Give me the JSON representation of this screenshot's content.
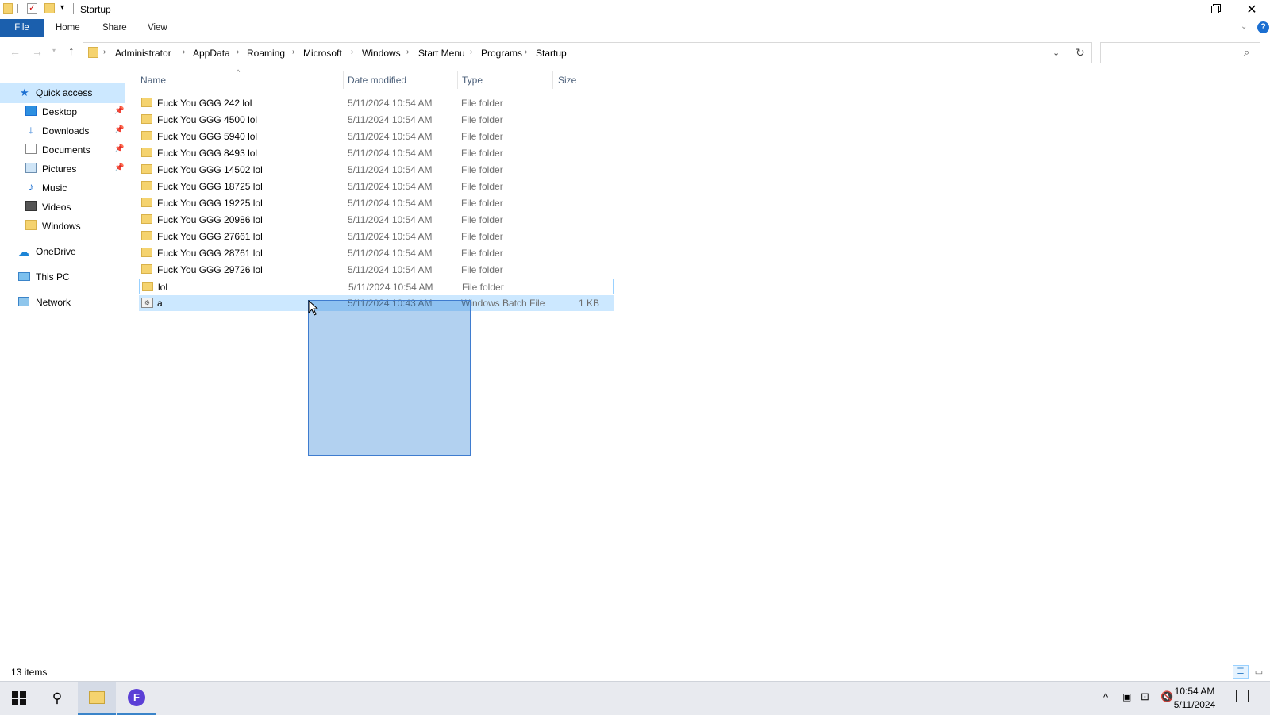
{
  "window": {
    "title": "Startup"
  },
  "ribbon": {
    "tabs": [
      "File",
      "Home",
      "Share",
      "View"
    ]
  },
  "address": {
    "crumbs": [
      "Administrator",
      "AppData",
      "Roaming",
      "Microsoft",
      "Windows",
      "Start Menu",
      "Programs",
      "Startup"
    ],
    "search_placeholder": ""
  },
  "sidebar": {
    "quick_access": "Quick access",
    "items": [
      {
        "label": "Desktop",
        "icon": "desktop-icon",
        "pinned": true
      },
      {
        "label": "Downloads",
        "icon": "downloads-icon",
        "pinned": true
      },
      {
        "label": "Documents",
        "icon": "documents-icon",
        "pinned": true
      },
      {
        "label": "Pictures",
        "icon": "pictures-icon",
        "pinned": true
      },
      {
        "label": "Music",
        "icon": "music-icon",
        "pinned": false
      },
      {
        "label": "Videos",
        "icon": "videos-icon",
        "pinned": false
      },
      {
        "label": "Windows",
        "icon": "folder-icon",
        "pinned": false
      }
    ],
    "onedrive": "OneDrive",
    "this_pc": "This PC",
    "network": "Network"
  },
  "columns": {
    "name": "Name",
    "date": "Date modified",
    "type": "Type",
    "size": "Size"
  },
  "files": [
    {
      "name": "Fuck You  GGG 242 lol",
      "date": "5/11/2024 10:54 AM",
      "type": "File folder",
      "size": ""
    },
    {
      "name": "Fuck You  GGG 4500 lol",
      "date": "5/11/2024 10:54 AM",
      "type": "File folder",
      "size": ""
    },
    {
      "name": "Fuck You  GGG 5940 lol",
      "date": "5/11/2024 10:54 AM",
      "type": "File folder",
      "size": ""
    },
    {
      "name": "Fuck You  GGG 8493 lol",
      "date": "5/11/2024 10:54 AM",
      "type": "File folder",
      "size": ""
    },
    {
      "name": "Fuck You  GGG 14502 lol",
      "date": "5/11/2024 10:54 AM",
      "type": "File folder",
      "size": ""
    },
    {
      "name": "Fuck You  GGG 18725 lol",
      "date": "5/11/2024 10:54 AM",
      "type": "File folder",
      "size": ""
    },
    {
      "name": "Fuck You  GGG 19225 lol",
      "date": "5/11/2024 10:54 AM",
      "type": "File folder",
      "size": ""
    },
    {
      "name": "Fuck You  GGG 20986 lol",
      "date": "5/11/2024 10:54 AM",
      "type": "File folder",
      "size": ""
    },
    {
      "name": "Fuck You  GGG 27661 lol",
      "date": "5/11/2024 10:54 AM",
      "type": "File folder",
      "size": ""
    },
    {
      "name": "Fuck You  GGG 28761 lol",
      "date": "5/11/2024 10:54 AM",
      "type": "File folder",
      "size": ""
    },
    {
      "name": "Fuck You  GGG 29726 lol",
      "date": "5/11/2024 10:54 AM",
      "type": "File folder",
      "size": ""
    },
    {
      "name": "lol",
      "date": "5/11/2024 10:54 AM",
      "type": "File folder",
      "size": ""
    },
    {
      "name": "a",
      "date": "5/11/2024 10:43 AM",
      "type": "Windows Batch File",
      "size": "1 KB"
    }
  ],
  "status": {
    "item_count": "13 items"
  },
  "taskbar": {
    "time": "10:54 AM",
    "date": "5/11/2024"
  },
  "colors": {
    "accent": "#1b5fad",
    "selection": "#cce8ff",
    "folder": "#f5d36f"
  }
}
